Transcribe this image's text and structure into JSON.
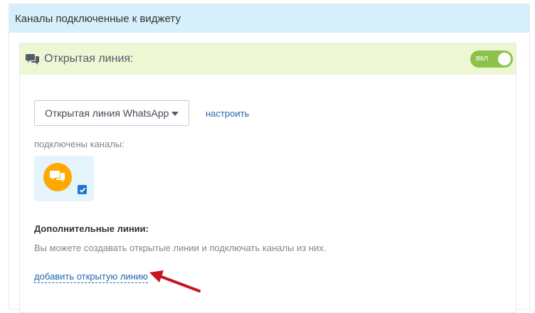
{
  "panel": {
    "title": "Каналы подключенные к виджету"
  },
  "open_line_card": {
    "title": "Открытая линия:",
    "toggle_label": "вкл",
    "toggle_on": true,
    "select_value": "Открытая линия WhatsApp",
    "configure_link": "настроить",
    "channels_label": "подключены каналы:",
    "channel_checked": true
  },
  "additional": {
    "title": "Дополнительные линии:",
    "description": "Вы можете создавать открытые линии и подключать каналы из них.",
    "add_link": "добавить открытую линию"
  },
  "icons": {
    "header": "chat-bubbles-icon",
    "channel": "chat-bubbles-icon",
    "check": "checkbox-checked-icon",
    "caret": "caret-down-icon",
    "annotation": "red-arrow-annotation"
  },
  "colors": {
    "panel_header_bg": "#d6f0fb",
    "card_header_bg": "#edf7d4",
    "toggle_bg": "#8bc34a",
    "link": "#2067b0",
    "channel_circle": "#ffa900",
    "arrow": "#c4161c"
  }
}
